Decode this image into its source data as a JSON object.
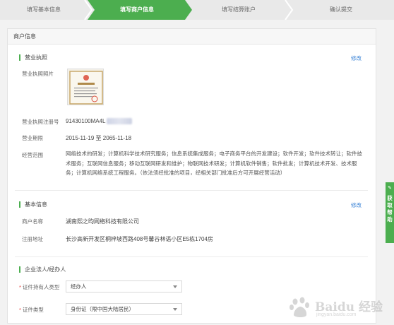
{
  "steps": [
    {
      "label": "填写基本信息",
      "state": "done"
    },
    {
      "label": "填写商户信息",
      "state": "active"
    },
    {
      "label": "填写结算账户",
      "state": "todo"
    },
    {
      "label": "确认提交",
      "state": "todo"
    }
  ],
  "colors": {
    "active_step": "#4cae4f",
    "link": "#3a83d6",
    "required": "#e53935",
    "inactive_step": "#e9e9e9"
  },
  "card": {
    "title": "商户信息"
  },
  "business_license": {
    "section_title": "营业执照",
    "edit_label": "修改",
    "photo_label": "营业执照照片",
    "reg_no_label": "营业执照注册号",
    "reg_no_value": "91430100MA4L",
    "period_label": "营业期限",
    "period_value": "2015-11-19 至 2065-11-18",
    "scope_label": "经营范围",
    "scope_value": "网络技术的研发；计算机科学技术研究服务；信息系统集成服务；电子商务平台的开发建设；软件开发；软件技术转让；软件技术服务；互联网信息服务；移动互联网研发和维护；物联网技术研发；计算机软件销售；软件批发；计算机技术开发、技术服务；计算机网络系统工程服务。（依法须经批准的项目，经相关部门批准后方可开展经营活动）"
  },
  "basic_info": {
    "section_title": "基本信息",
    "edit_label": "修改",
    "merchant_name_label": "商户名称",
    "merchant_name_value": "湖南熙之昀网络科技有限公司",
    "address_label": "注册地址",
    "address_value": "长沙高新开发区桐梓坡西路408号馨谷林语小区E5栋1704房"
  },
  "legal_person": {
    "section_title": "企业法人/经办人",
    "holder_type_label": "证件持有人类型",
    "holder_type_value": "经办人",
    "id_type_label": "证件类型",
    "id_type_value": "身份证（限中国大陆居民）"
  },
  "side_tab": {
    "label": "获取帮助"
  },
  "watermark": {
    "text": "Baidu 经验",
    "url": "jingyan.baidu.com"
  }
}
